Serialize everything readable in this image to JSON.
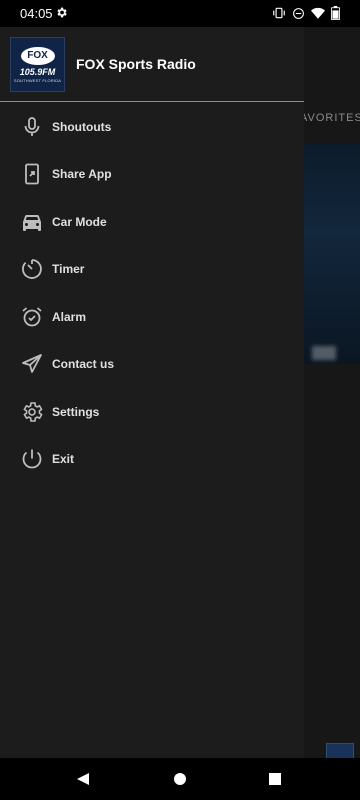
{
  "status_bar": {
    "time": "04:05"
  },
  "background": {
    "tab_label": "AVORITES"
  },
  "drawer": {
    "app_title": "FOX Sports Radio",
    "logo": {
      "brand": "FOX",
      "freq": "105.9FM",
      "sub": "SOUTHWEST FLORIDA"
    },
    "menu_items": [
      {
        "label": "Shoutouts",
        "icon": "microphone-icon"
      },
      {
        "label": "Share App",
        "icon": "share-phone-icon"
      },
      {
        "label": "Car Mode",
        "icon": "car-icon"
      },
      {
        "label": "Timer",
        "icon": "timer-icon"
      },
      {
        "label": "Alarm",
        "icon": "alarm-clock-icon"
      },
      {
        "label": "Contact us",
        "icon": "send-icon"
      },
      {
        "label": "Settings",
        "icon": "gear-icon"
      },
      {
        "label": "Exit",
        "icon": "power-icon"
      }
    ]
  },
  "colors": {
    "drawer_bg": "#1c1c1c",
    "text": "#e0e0e0",
    "icon": "#bdbdbd"
  }
}
